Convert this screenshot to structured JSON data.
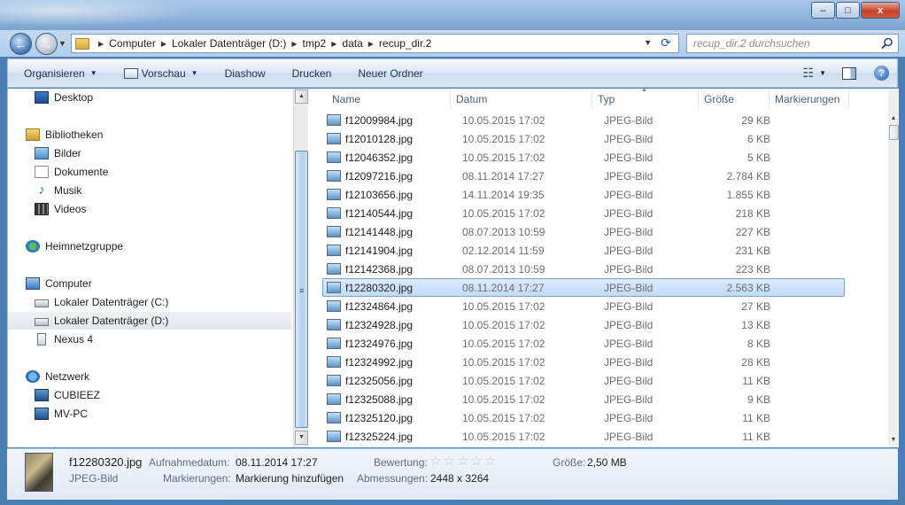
{
  "window": {
    "buttons": {
      "minimize": "–",
      "maximize": "□",
      "close": "x"
    }
  },
  "nav": {
    "back": "←",
    "forward": "→"
  },
  "address": {
    "crumbs": [
      "Computer",
      "Lokaler Datenträger (D:)",
      "tmp2",
      "data",
      "recup_dir.2"
    ]
  },
  "search": {
    "placeholder": "recup_dir.2 durchsuchen"
  },
  "toolbar": {
    "organize": "Organisieren",
    "preview": "Vorschau",
    "slideshow": "Diashow",
    "print": "Drucken",
    "new_folder": "Neuer Ordner",
    "help": "?"
  },
  "navpane": {
    "desktop": "Desktop",
    "libraries": "Bibliotheken",
    "pictures": "Bilder",
    "documents": "Dokumente",
    "music": "Musik",
    "videos": "Videos",
    "homegroup": "Heimnetzgruppe",
    "computer": "Computer",
    "drive_c": "Lokaler Datenträger (C:)",
    "drive_d": "Lokaler Datenträger (D:)",
    "nexus": "Nexus 4",
    "network": "Netzwerk",
    "pc1": "CUBIEEZ",
    "pc2": "MV-PC"
  },
  "columns": {
    "name": "Name",
    "date": "Datum",
    "type": "Typ",
    "size": "Größe",
    "tags": "Markierungen"
  },
  "files": [
    {
      "name": "f12009984.jpg",
      "date": "10.05.2015 17:02",
      "type": "JPEG-Bild",
      "size": "29 KB"
    },
    {
      "name": "f12010128.jpg",
      "date": "10.05.2015 17:02",
      "type": "JPEG-Bild",
      "size": "6 KB"
    },
    {
      "name": "f12046352.jpg",
      "date": "10.05.2015 17:02",
      "type": "JPEG-Bild",
      "size": "5 KB"
    },
    {
      "name": "f12097216.jpg",
      "date": "08.11.2014 17:27",
      "type": "JPEG-Bild",
      "size": "2.784 KB"
    },
    {
      "name": "f12103656.jpg",
      "date": "14.11.2014 19:35",
      "type": "JPEG-Bild",
      "size": "1.855 KB"
    },
    {
      "name": "f12140544.jpg",
      "date": "10.05.2015 17:02",
      "type": "JPEG-Bild",
      "size": "218 KB"
    },
    {
      "name": "f12141448.jpg",
      "date": "08.07.2013 10:59",
      "type": "JPEG-Bild",
      "size": "227 KB"
    },
    {
      "name": "f12141904.jpg",
      "date": "02.12.2014 11:59",
      "type": "JPEG-Bild",
      "size": "231 KB"
    },
    {
      "name": "f12142368.jpg",
      "date": "08.07.2013 10:59",
      "type": "JPEG-Bild",
      "size": "223 KB"
    },
    {
      "name": "f12280320.jpg",
      "date": "08.11.2014 17:27",
      "type": "JPEG-Bild",
      "size": "2.563 KB"
    },
    {
      "name": "f12324864.jpg",
      "date": "10.05.2015 17:02",
      "type": "JPEG-Bild",
      "size": "27 KB"
    },
    {
      "name": "f12324928.jpg",
      "date": "10.05.2015 17:02",
      "type": "JPEG-Bild",
      "size": "13 KB"
    },
    {
      "name": "f12324976.jpg",
      "date": "10.05.2015 17:02",
      "type": "JPEG-Bild",
      "size": "8 KB"
    },
    {
      "name": "f12324992.jpg",
      "date": "10.05.2015 17:02",
      "type": "JPEG-Bild",
      "size": "28 KB"
    },
    {
      "name": "f12325056.jpg",
      "date": "10.05.2015 17:02",
      "type": "JPEG-Bild",
      "size": "11 KB"
    },
    {
      "name": "f12325088.jpg",
      "date": "10.05.2015 17:02",
      "type": "JPEG-Bild",
      "size": "9 KB"
    },
    {
      "name": "f12325120.jpg",
      "date": "10.05.2015 17:02",
      "type": "JPEG-Bild",
      "size": "11 KB"
    },
    {
      "name": "f12325224.jpg",
      "date": "10.05.2015 17:02",
      "type": "JPEG-Bild",
      "size": "11 KB"
    }
  ],
  "selected_index": 9,
  "details": {
    "filename": "f12280320.jpg",
    "filetype": "JPEG-Bild",
    "date_label": "Aufnahmedatum:",
    "date_value": "08.11.2014 17:27",
    "tags_label": "Markierungen:",
    "tags_value": "Markierung hinzufügen",
    "rating_label": "Bewertung:",
    "rating_value": 0,
    "dims_label": "Abmessungen:",
    "dims_value": "2448 x 3264",
    "size_label": "Größe:",
    "size_value": "2,50 MB"
  }
}
